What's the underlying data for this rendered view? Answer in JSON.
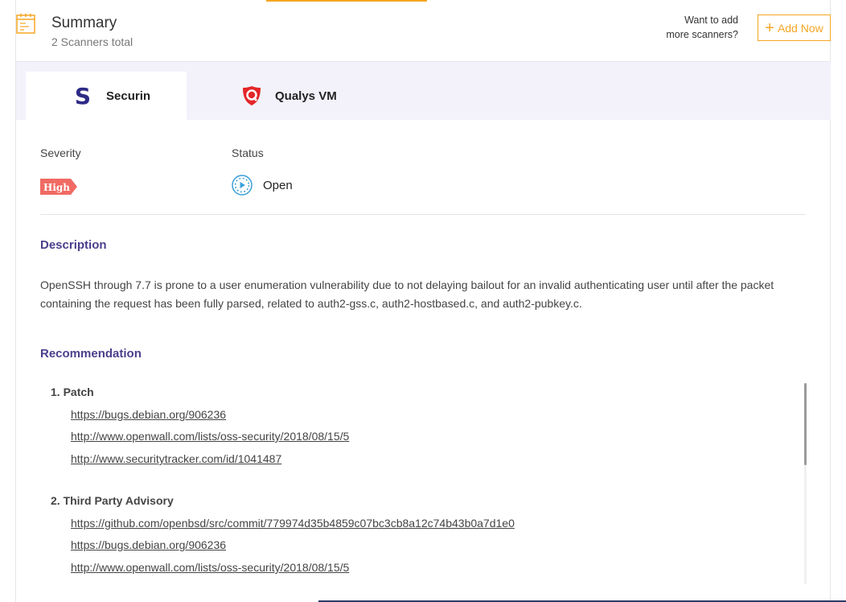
{
  "header": {
    "title": "Summary",
    "subtitle": "2 Scanners total",
    "want_add_line1": "Want to add",
    "want_add_line2": "more scanners?",
    "add_now_plus": "+",
    "add_now_label": "Add Now"
  },
  "tabs": [
    {
      "label": "Securin",
      "logo_text": "S",
      "active": true
    },
    {
      "label": "Qualys VM",
      "active": false
    }
  ],
  "details": {
    "severity_label": "Severity",
    "severity_value": "High",
    "status_label": "Status",
    "status_value": "Open"
  },
  "description": {
    "title": "Description",
    "text": "OpenSSH through 7.7 is prone to a user enumeration vulnerability due to not delaying bailout for an invalid authenticating user until after the packet containing the request has been fully parsed, related to auth2-gss.c, auth2-hostbased.c, and auth2-pubkey.c."
  },
  "recommendation": {
    "title": "Recommendation",
    "groups": [
      {
        "title": "1. Patch",
        "links": [
          "https://bugs.debian.org/906236",
          "http://www.openwall.com/lists/oss-security/2018/08/15/5",
          "http://www.securitytracker.com/id/1041487"
        ]
      },
      {
        "title": "2. Third Party Advisory",
        "links": [
          "https://github.com/openbsd/src/commit/779974d35b4859c07bc3cb8a12c74b43b0a7d1e0",
          "https://bugs.debian.org/906236",
          "http://www.openwall.com/lists/oss-security/2018/08/15/5"
        ]
      }
    ]
  },
  "colors": {
    "accent": "#f5a623",
    "heading": "#4a3f8c",
    "high_badge": "#f06a63",
    "status_icon": "#3aa0d8",
    "tab_bar": "#f3f2fb"
  },
  "icons": {
    "summary": "calendar-icon",
    "securin": "securin-logo",
    "qualys": "qualys-shield-icon",
    "status": "open-status-icon"
  }
}
